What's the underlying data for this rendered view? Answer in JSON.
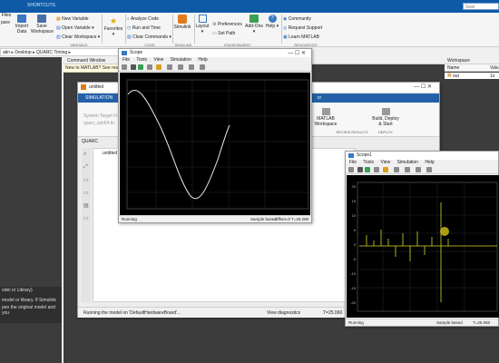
{
  "quick_access": {
    "shortcuts_tab": "SHORTCUTS",
    "search_placeholder": "Sear"
  },
  "ribbon": {
    "files_label": "Files",
    "compare_label": "pare",
    "import_data": "Import Data",
    "save_workspace": "Save Workspace",
    "new_variable": "New Variable",
    "open_variable": "Open Variable",
    "clear_workspace": "Clear Workspace",
    "favorites": "Favorites",
    "analyze_code": "Analyze Code",
    "run_and_time": "Run and Time",
    "clear_commands": "Clear Commands",
    "simulink": "Simulink",
    "layout": "Layout",
    "preferences": "Preferences",
    "set_path": "Set Path",
    "add_ons": "Add-Ons",
    "help": "Help",
    "community": "Community",
    "request_support": "Request Support",
    "learn_matlab": "Learn MATLAB",
    "section_variable": "VARIABLE",
    "section_code": "CODE",
    "section_simulink": "SIMULINK",
    "section_environment": "ENVIRONMENT",
    "section_resources": "RESOURCES"
  },
  "address_bar": {
    "path": "atin ▸ Desktop ▸ QUARC Timing ▸"
  },
  "command_window": {
    "title": "Command Window",
    "notice": "New to MATLAB? See reso",
    "status_text": "Running the model on 'DefaultHardwareBoard'...",
    "view_diagnostics": "View diagnostics",
    "timestamp": "T=25.060"
  },
  "left_panel": {
    "lines": [
      "odel or Library)",
      "model or library. If Simulink",
      "pen the original model and you"
    ]
  },
  "workspace": {
    "title": "Workspace",
    "col_name": "Name",
    "col_value": "Valu",
    "row_name": "out",
    "row_value": "1x"
  },
  "simulink_window": {
    "title": "untitled",
    "tab": "SIMULATION",
    "url_hint": "cr",
    "matlab_workspace": "MATLAB Workspace",
    "build_deploy": "Build, Deploy & Start",
    "review_results": "REVIEW RESULTS",
    "deploy": "DEPLOY",
    "system_target": "System Target Fi",
    "quarc_label": "QUARC",
    "tree_item": "untitled",
    "browser_text": "quarc_win64.tlc"
  },
  "scope": {
    "title": "Scope",
    "menu": [
      "File",
      "Tools",
      "View",
      "Simulation",
      "Help"
    ],
    "status_running": "Running",
    "status_sample": "Sample based",
    "status_offset": "Offset=0",
    "status_time": "T=25.280"
  },
  "scope1": {
    "title": "Scope1",
    "menu": [
      "File",
      "Tools",
      "View",
      "Simulation",
      "Help"
    ],
    "status_running": "Running",
    "status_sample": "Sample based",
    "status_time": "T=25.060",
    "y_ticks": [
      "20",
      "15",
      "10",
      "5",
      "0",
      "-5",
      "-10",
      "-15",
      "-20"
    ]
  },
  "colors": {
    "matlab_blue": "#0e5aa7",
    "trace_white": "#e8e8e8",
    "trace_yellow": "#d8d82a",
    "cursor_yellow": "#c9b817"
  }
}
